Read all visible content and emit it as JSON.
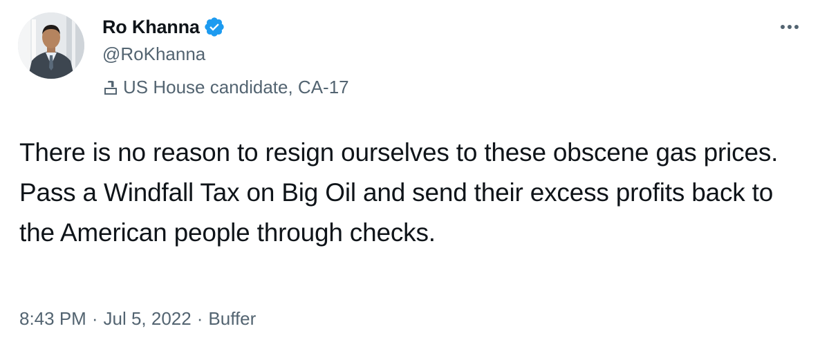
{
  "author": {
    "display_name": "Ro Khanna",
    "handle": "@RoKhanna",
    "verified": true,
    "label": "US House candidate, CA-17",
    "label_icon": "ballot-box-icon",
    "avatar_icon": "profile-photo"
  },
  "tweet": {
    "text": "There is no reason to resign ourselves to these obscene gas prices. Pass a Windfall Tax on Big Oil and send their excess profits back to the American people through checks.",
    "time": "8:43 PM",
    "separator": "·",
    "date": "Jul 5, 2022",
    "source": "Buffer"
  },
  "menu": {
    "more_icon": "more-horizontal-icon"
  },
  "colors": {
    "primary_text": "#0f1419",
    "secondary_text": "#536471",
    "verified_blue": "#1d9bf0",
    "background": "#ffffff"
  }
}
